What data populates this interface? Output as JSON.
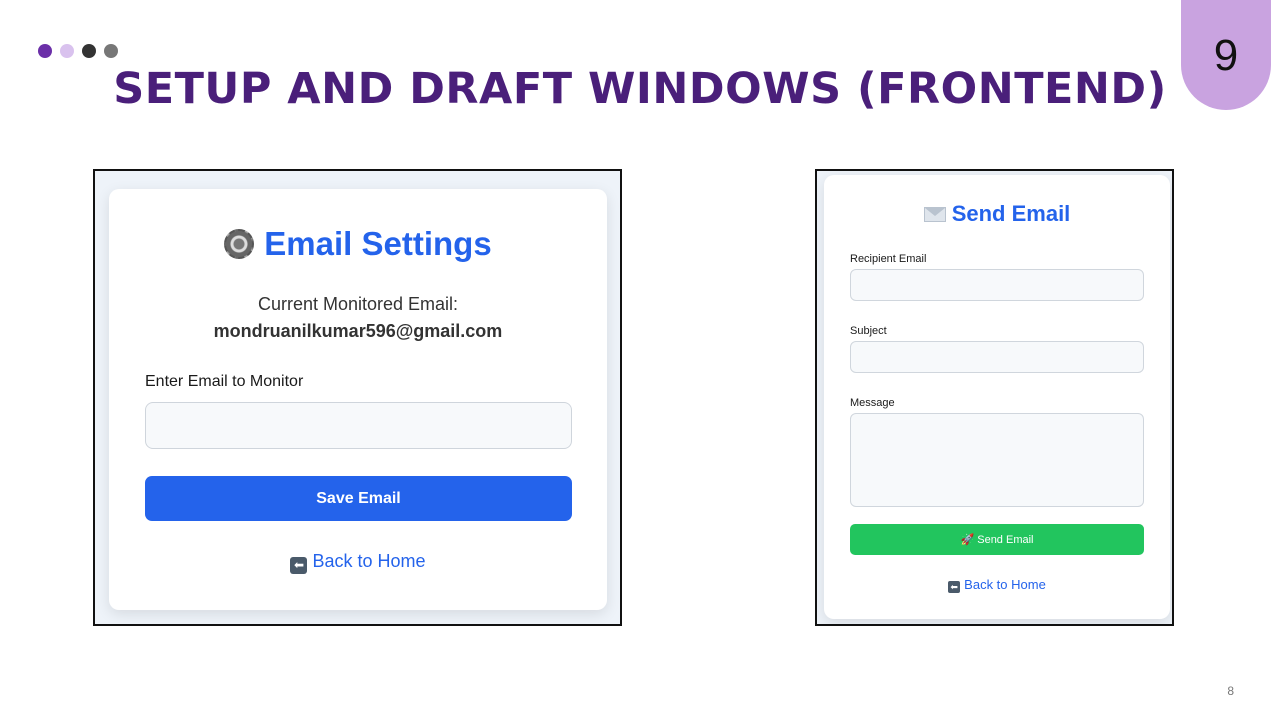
{
  "slide": {
    "title": "SETUP AND DRAFT WINDOWS (FRONTEND)",
    "title_color": "#4a1f7a",
    "slide_number": "9",
    "slide_number_bg": "#c9a3e0",
    "page_number": "8",
    "dot_colors": [
      "#6b2fa8",
      "#d9c2ee",
      "#333333",
      "#777777"
    ]
  },
  "settings_window": {
    "icon": "gear-icon",
    "title": "Email Settings",
    "current_label": "Current Monitored Email:",
    "current_email": "mondruanilkumar596@gmail.com",
    "input_label": "Enter Email to Monitor",
    "input_value": "",
    "save_button": "Save Email",
    "back_link": "Back to Home",
    "back_icon": "back-arrow-icon",
    "accent_color": "#2463eb"
  },
  "send_window": {
    "icon": "envelope-icon",
    "title": "Send Email",
    "recipient_label": "Recipient Email",
    "recipient_value": "",
    "subject_label": "Subject",
    "subject_value": "",
    "message_label": "Message",
    "message_value": "",
    "send_button": "🚀 Send Email",
    "back_link": "Back to Home",
    "back_icon": "back-arrow-icon",
    "button_color": "#22c55e"
  }
}
